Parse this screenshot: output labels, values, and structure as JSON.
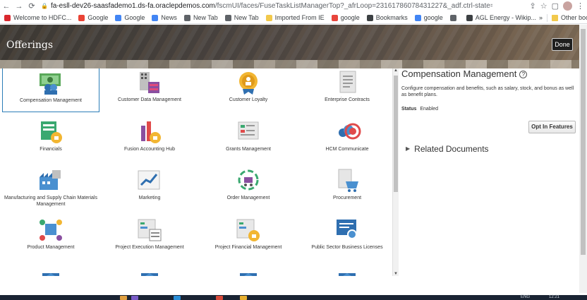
{
  "browser": {
    "url_host": "fa-esll-dev26-saasfademo1.ds-fa.oraclepdemos.com",
    "url_path": "/fscmUI/faces/FuseTaskListManagerTop?_afrLoop=23161786078431227&_adf.ctrl-state=185lgn9t7k_196",
    "bookmarks": [
      {
        "label": "Welcome to HDFC...",
        "color": "#d9282f"
      },
      {
        "label": "Google",
        "color": "#ea4335"
      },
      {
        "label": "Google",
        "color": "#4285f4"
      },
      {
        "label": "News",
        "color": "#4285f4"
      },
      {
        "label": "New Tab",
        "color": "#5f6368"
      },
      {
        "label": "New Tab",
        "color": "#5f6368"
      },
      {
        "label": "Imported From IE",
        "color": "#f2c94c"
      },
      {
        "label": "google",
        "color": "#e8453c"
      },
      {
        "label": "Bookmarks",
        "color": "#3c4043"
      },
      {
        "label": "google",
        "color": "#4285f4"
      },
      {
        "label": "",
        "color": "#5f6368"
      },
      {
        "label": "AGL Energy - Wikip...",
        "color": "#3c4043"
      }
    ],
    "more_bookmarks": "»",
    "other_bookmarks": "Other bookmarks"
  },
  "header": {
    "title": "Offerings",
    "done_label": "Done"
  },
  "offerings": [
    {
      "label": "Compensation Management",
      "icon": "compensation-icon",
      "selected": true
    },
    {
      "label": "Customer Data Management",
      "icon": "customer-data-icon"
    },
    {
      "label": "Customer Loyalty",
      "icon": "loyalty-badge-icon"
    },
    {
      "label": "Enterprise Contracts",
      "icon": "contract-document-icon"
    },
    {
      "label": "Financials",
      "icon": "financials-icon"
    },
    {
      "label": "Fusion Accounting Hub",
      "icon": "accounting-hub-icon"
    },
    {
      "label": "Grants Management",
      "icon": "grants-icon"
    },
    {
      "label": "HCM Communicate",
      "icon": "hcm-communicate-icon"
    },
    {
      "label": "Manufacturing and Supply Chain Materials Management",
      "icon": "manufacturing-icon"
    },
    {
      "label": "Marketing",
      "icon": "marketing-chart-icon"
    },
    {
      "label": "Order Management",
      "icon": "order-cart-icon"
    },
    {
      "label": "Procurement",
      "icon": "procurement-icon"
    },
    {
      "label": "Product Management",
      "icon": "product-icon"
    },
    {
      "label": "Project Execution Management",
      "icon": "project-execution-icon"
    },
    {
      "label": "Project Financial Management",
      "icon": "project-financial-icon"
    },
    {
      "label": "Public Sector Business Licenses",
      "icon": "business-license-icon"
    },
    {
      "label": "",
      "icon": "partial-icon"
    },
    {
      "label": "",
      "icon": "partial-icon"
    },
    {
      "label": "",
      "icon": "partial-icon"
    },
    {
      "label": "",
      "icon": "partial-icon"
    }
  ],
  "detail": {
    "title": "Compensation Management",
    "help": "?",
    "description": "Configure compensation and benefits, such as salary, stock, and bonus as well as benefit plans.",
    "status_label": "Status",
    "status_value": "Enabled",
    "opt_in_label": "Opt In Features",
    "related_label": "Related Documents"
  },
  "taskbar": {
    "lang": "ENG",
    "time": "12:21"
  }
}
